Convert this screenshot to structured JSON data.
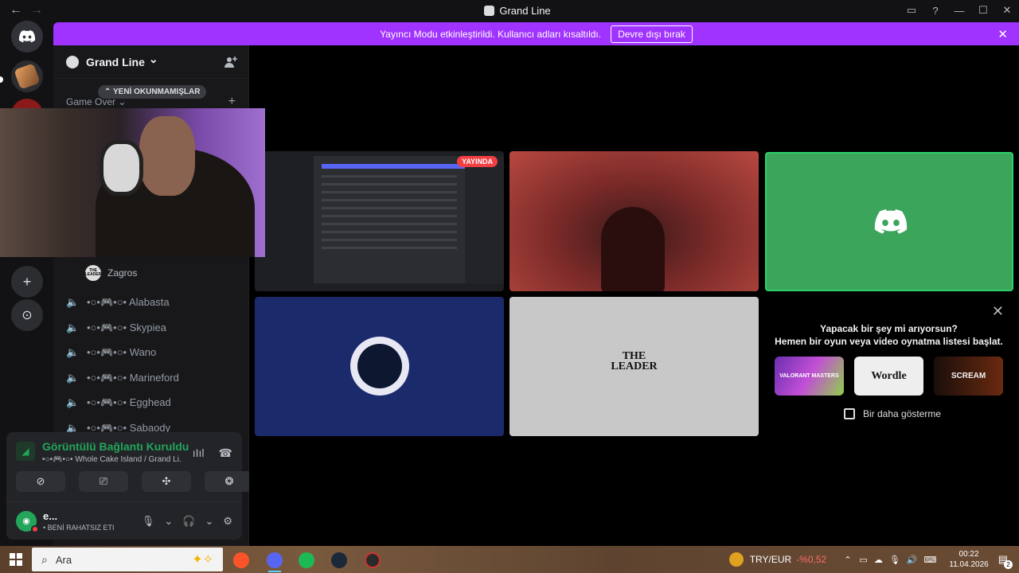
{
  "window": {
    "title": "Grand Line",
    "back": "←",
    "forward": "→",
    "controls": [
      "▭",
      "?",
      "—",
      "☐",
      "✕"
    ]
  },
  "banner": {
    "text": "Yayıncı Modu etkinleştirildi. Kullanıcı adları kısaltıldı.",
    "button": "Devre dışı bırak",
    "close": "✕"
  },
  "guild": {
    "name": "Grand Line",
    "chevron": "⌄",
    "unread_pill": "⌃ YENİ OKUNMAMIŞLAR",
    "category": "Game Over ⌄",
    "category_add": "+",
    "member": {
      "name": "Zagros",
      "avatar_text": "THE LEADER"
    },
    "voice_channels": [
      {
        "name": "•○•🎮•○• Alabasta"
      },
      {
        "name": "•○•🎮•○• Skypiea"
      },
      {
        "name": "•○•🎮•○• Wano"
      },
      {
        "name": "•○•🎮•○• Marineford"
      },
      {
        "name": "•○•🎮•○• Egghead"
      },
      {
        "name": "•○•🎮•○• Sabaody"
      }
    ]
  },
  "voice_panel": {
    "status": "Görüntülü Bağlantı Kuruldu",
    "channel": "•○•🎮•○• Whole Cake Island / Grand Li...",
    "buttons": [
      "camera-off",
      "screen-share",
      "activities",
      "soundboard"
    ]
  },
  "user": {
    "name": "e...",
    "status": "• BENİ RAHATSIZ ETI"
  },
  "stage": {
    "live_badge": "YAYINDA",
    "leader_text_1": "THE",
    "leader_text_2": "LEADER"
  },
  "activity_card": {
    "title_line1": "Yapacak bir şey mi arıyorsun?",
    "title_line2": "Hemen bir oyun veya video oynatma listesi başlat.",
    "games": [
      "VALORANT MASTERS",
      "Wordle",
      "SCREAM"
    ],
    "checkbox_label": "Bir daha gösterme",
    "close": "✕"
  },
  "taskbar": {
    "search_placeholder": "Ara",
    "currency": "TRY/EUR",
    "currency_change": "-%0,52",
    "time": "00:22",
    "date": "11.04.2026",
    "notifications": "2"
  },
  "colors": {
    "banner": "#a033ff",
    "green": "#23a55a",
    "red": "#f23f43",
    "blurple": "#5865f2"
  }
}
